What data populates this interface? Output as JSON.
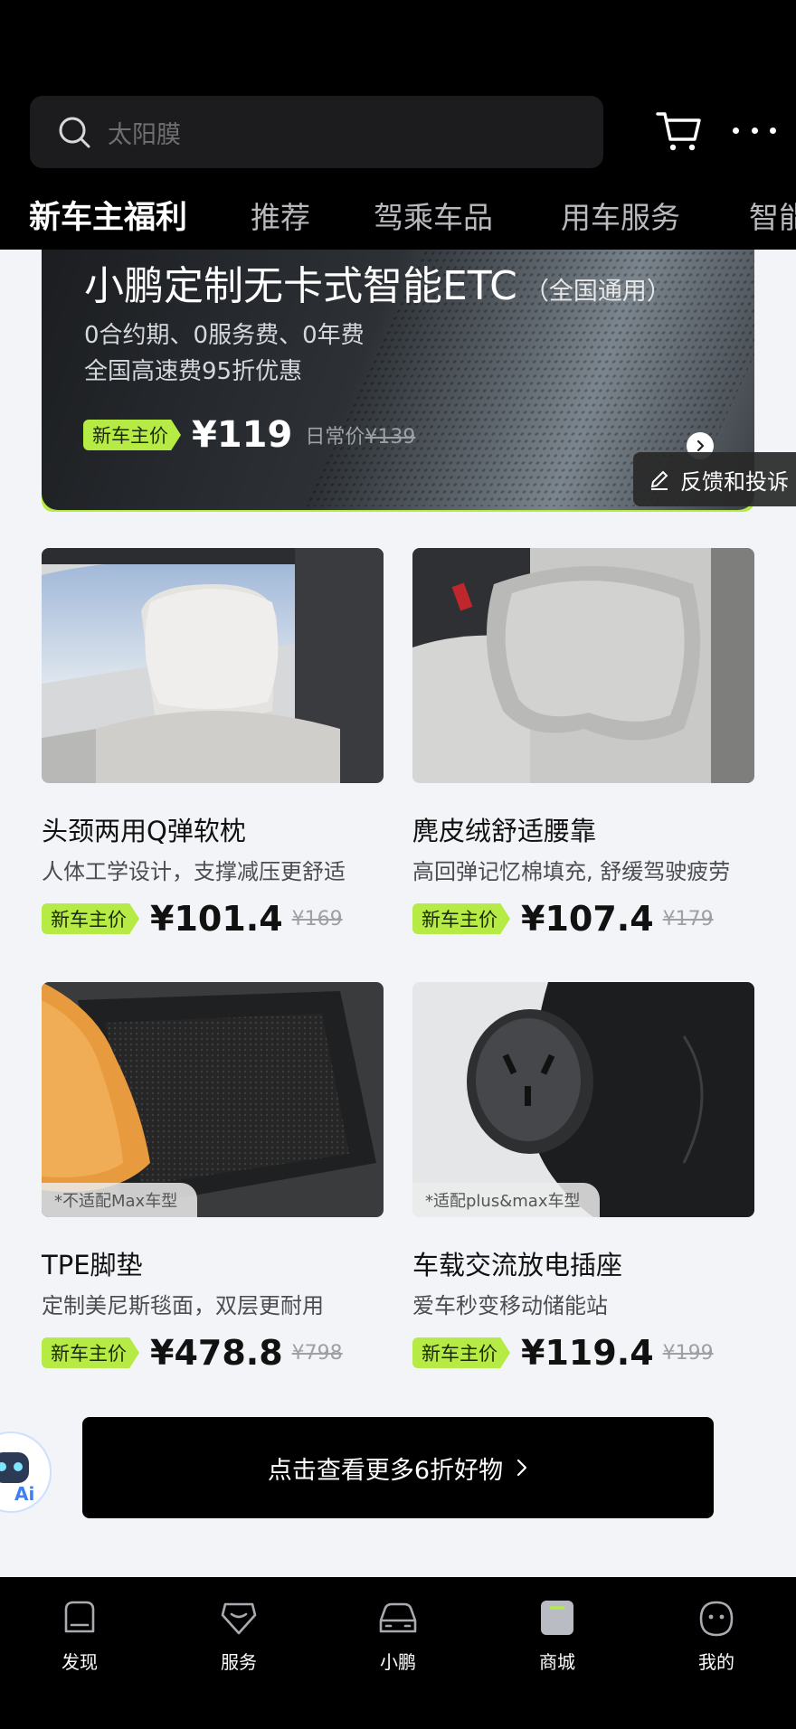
{
  "search": {
    "placeholder": "太阳膜"
  },
  "tabs": [
    {
      "label": "新车主福利",
      "active": true
    },
    {
      "label": "推荐"
    },
    {
      "label": "驾乘车品"
    },
    {
      "label": "用车服务"
    },
    {
      "label": "智能"
    }
  ],
  "banner": {
    "title": "小鹏定制无卡式智能ETC",
    "title_suffix": "（全国通用）",
    "line1": "0合约期、0服务费、0年费",
    "line2": "全国高速费95折优惠",
    "badge": "新车主价",
    "price": "¥119",
    "old_label": "日常价",
    "old_price": "¥139"
  },
  "feedback": {
    "label": "反馈和投诉"
  },
  "products": [
    {
      "name": "头颈两用Q弹软枕",
      "desc": "人体工学设计，支撑减压更舒适",
      "badge": "新车主价",
      "price": "¥101.4",
      "old_price": "¥169",
      "note": ""
    },
    {
      "name": "麂皮绒舒适腰靠",
      "desc": "高回弹记忆棉填充, 舒缓驾驶疲劳",
      "badge": "新车主价",
      "price": "¥107.4",
      "old_price": "¥179",
      "note": ""
    },
    {
      "name": "TPE脚垫",
      "desc": "定制美尼斯毯面，双层更耐用",
      "badge": "新车主价",
      "price": "¥478.8",
      "old_price": "¥798",
      "note": "*不适配Max车型"
    },
    {
      "name": "车载交流放电插座",
      "desc": "爱车秒变移动储能站",
      "badge": "新车主价",
      "price": "¥119.4",
      "old_price": "¥199",
      "note": "*适配plus&max车型"
    }
  ],
  "cta": {
    "label": "点击查看更多6折好物"
  },
  "ai_badge": "Ai",
  "bottom_nav": [
    {
      "label": "发现",
      "icon": "discover-icon"
    },
    {
      "label": "服务",
      "icon": "service-icon"
    },
    {
      "label": "小鹏",
      "icon": "car-icon"
    },
    {
      "label": "商城",
      "icon": "mall-icon",
      "active": true
    },
    {
      "label": "我的",
      "icon": "profile-icon"
    }
  ],
  "colors": {
    "accent": "#b6ea45",
    "header_bg": "#000000",
    "page_bg": "#f3f4f7"
  }
}
